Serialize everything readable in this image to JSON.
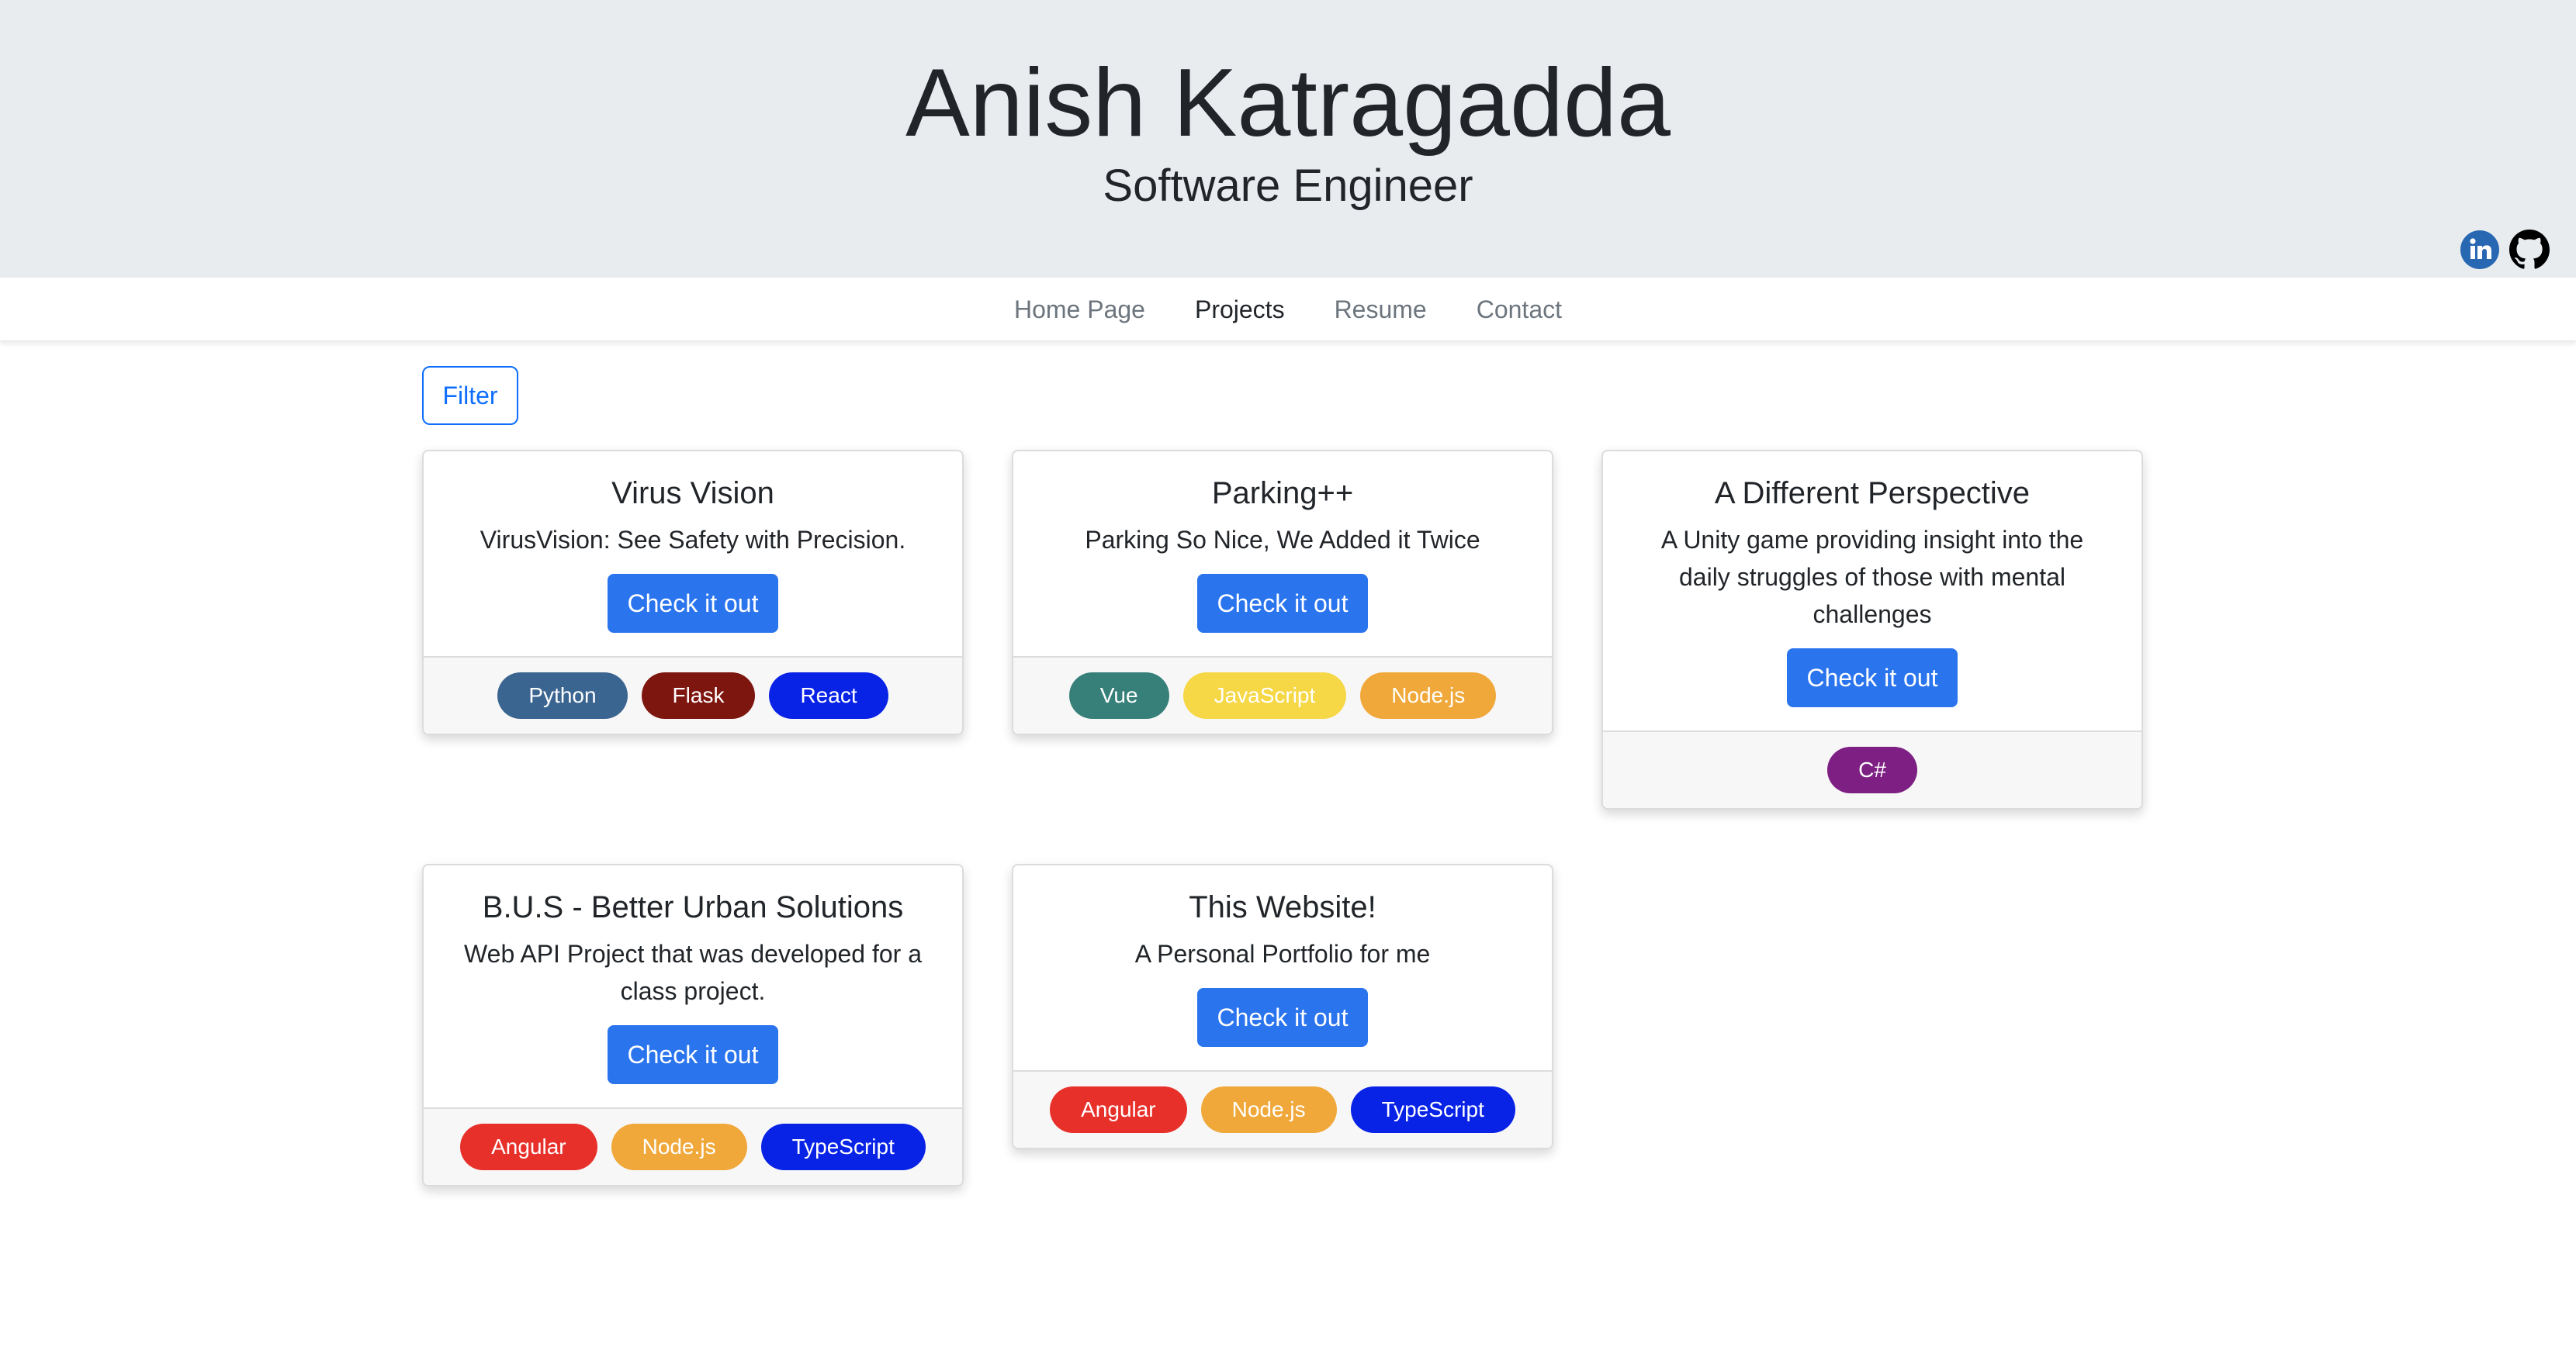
{
  "header": {
    "name": "Anish Katragadda",
    "title": "Software Engineer",
    "social": [
      {
        "icon": "linkedin-icon",
        "color": "#2867b2"
      },
      {
        "icon": "github-icon",
        "color": "#000000"
      }
    ]
  },
  "nav": {
    "items": [
      {
        "label": "Home Page",
        "active": false
      },
      {
        "label": "Projects",
        "active": true
      },
      {
        "label": "Resume",
        "active": false
      },
      {
        "label": "Contact",
        "active": false
      }
    ]
  },
  "filter": {
    "label": "Filter"
  },
  "projects": [
    {
      "title": "Virus Vision",
      "description": "VirusVision: See Safety with Precision.",
      "button": "Check it out",
      "tags": [
        {
          "label": "Python",
          "color": "#3b6591"
        },
        {
          "label": "Flask",
          "color": "#7e1610"
        },
        {
          "label": "React",
          "color": "#0822e6"
        }
      ]
    },
    {
      "title": "Parking++",
      "description": "Parking So Nice, We Added it Twice",
      "button": "Check it out",
      "tags": [
        {
          "label": "Vue",
          "color": "#37807a"
        },
        {
          "label": "JavaScript",
          "color": "#f6d745"
        },
        {
          "label": "Node.js",
          "color": "#f0a83a"
        }
      ]
    },
    {
      "title": "A Different Perspective",
      "description": "A Unity game providing insight into the daily struggles of those with mental challenges",
      "button": "Check it out",
      "tags": [
        {
          "label": "C#",
          "color": "#7d1f83"
        }
      ]
    },
    {
      "title": "B.U.S - Better Urban Solutions",
      "description": "Web API Project that was developed for a class project.",
      "button": "Check it out",
      "tags": [
        {
          "label": "Angular",
          "color": "#e8302a"
        },
        {
          "label": "Node.js",
          "color": "#f0a83a"
        },
        {
          "label": "TypeScript",
          "color": "#0822e6"
        }
      ]
    },
    {
      "title": "This Website!",
      "description": "A Personal Portfolio for me",
      "button": "Check it out",
      "tags": [
        {
          "label": "Angular",
          "color": "#e8302a"
        },
        {
          "label": "Node.js",
          "color": "#f0a83a"
        },
        {
          "label": "TypeScript",
          "color": "#0822e6"
        }
      ]
    }
  ]
}
